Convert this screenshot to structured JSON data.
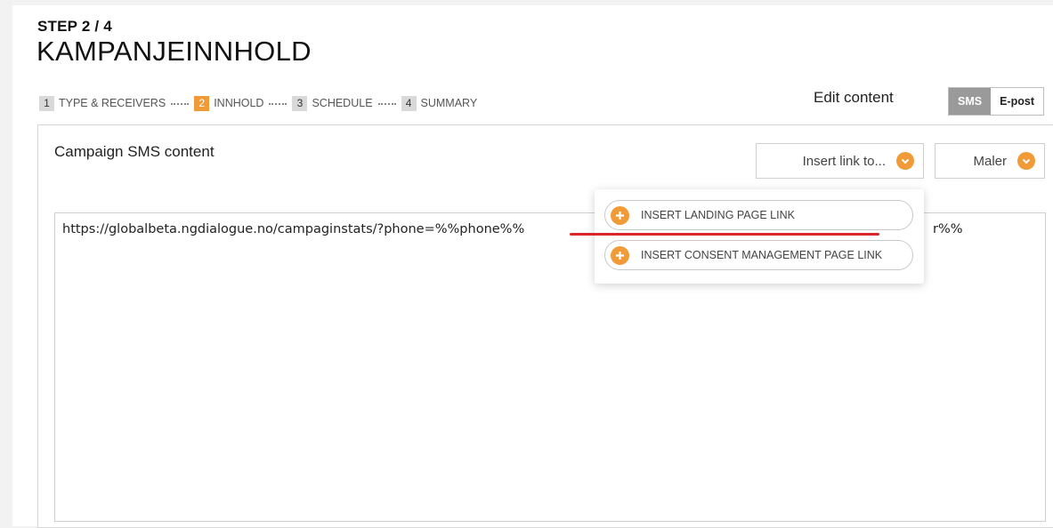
{
  "header": {
    "step_label": "STEP 2 / 4",
    "title": "KAMPANJEINNHOLD"
  },
  "steps": [
    {
      "num": "1",
      "label": "TYPE & RECEIVERS",
      "active": false
    },
    {
      "num": "2",
      "label": "INNHOLD",
      "active": true
    },
    {
      "num": "3",
      "label": "SCHEDULE",
      "active": false
    },
    {
      "num": "4",
      "label": "SUMMARY",
      "active": false
    }
  ],
  "edit_content": {
    "label": "Edit content",
    "options": [
      "SMS",
      "E-post"
    ],
    "selected": "SMS"
  },
  "panel": {
    "title": "Campaign SMS content",
    "insert_link_label": "Insert link to...",
    "maler_label": "Maler"
  },
  "sms": {
    "visible_text": "https://globalbeta.ngdialogue.no/campaginstats/?phone=%%phone%%",
    "visible_tail": "r%%"
  },
  "popup": {
    "items": [
      {
        "label": "INSERT LANDING PAGE LINK",
        "icon": "plus-circle-icon"
      },
      {
        "label": "INSERT CONSENT MANAGEMENT PAGE LINK",
        "icon": "plus-circle-icon"
      }
    ]
  },
  "colors": {
    "accent": "#f19b38",
    "annotation": "#d9262b",
    "switch_active": "#9a9a9a"
  }
}
